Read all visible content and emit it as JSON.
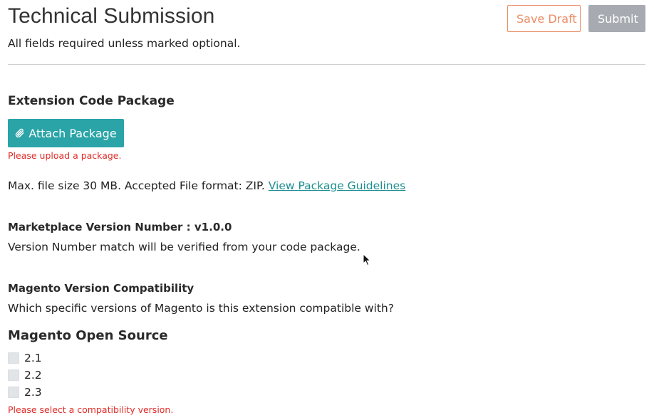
{
  "header": {
    "title": "Technical Submission",
    "subtitle": "All fields required unless marked optional.",
    "save_draft_label": "Save Draft",
    "submit_label": "Submit"
  },
  "package_section": {
    "heading": "Extension Code Package",
    "attach_button_label": "Attach Package",
    "attach_icon": "paperclip-icon",
    "error": "Please upload a package.",
    "info_text": "Max. file size 30 MB. Accepted File format: ZIP.",
    "guidelines_link": "View Package Guidelines"
  },
  "version_section": {
    "heading": "Marketplace Version Number : v1.0.0",
    "description": "Version Number match will be verified from your code package."
  },
  "compatibility_section": {
    "heading": "Magento Version Compatibility",
    "question": "Which specific versions of Magento is this extension compatible with?",
    "open_source_heading": "Magento Open Source",
    "versions": [
      {
        "label": "2.1",
        "checked": false
      },
      {
        "label": "2.2",
        "checked": false
      },
      {
        "label": "2.3",
        "checked": false
      }
    ],
    "error": "Please select a compatibility version."
  },
  "colors": {
    "accent_teal": "#2aa4a7",
    "link_teal": "#1b8e91",
    "save_draft_orange": "#eb8c65",
    "submit_disabled_gray": "#a7aab0",
    "error_red": "#e02b27"
  }
}
